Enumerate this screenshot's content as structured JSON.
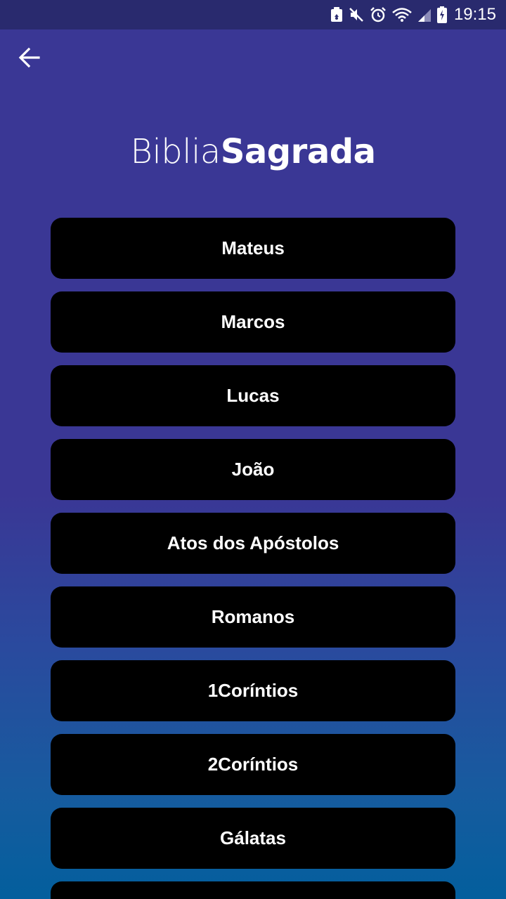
{
  "status_bar": {
    "time": "19:15",
    "icons": [
      "recycle-notification-icon",
      "mute-icon",
      "alarm-icon",
      "wifi-icon",
      "signal-icon",
      "battery-charging-icon"
    ]
  },
  "header": {
    "back_icon": "arrow-left-icon",
    "title_light": "Biblia",
    "title_bold": "Sagrada"
  },
  "books": [
    {
      "label": "Mateus"
    },
    {
      "label": "Marcos"
    },
    {
      "label": "Lucas"
    },
    {
      "label": "João"
    },
    {
      "label": "Atos dos Apóstolos"
    },
    {
      "label": "Romanos"
    },
    {
      "label": "1Coríntios"
    },
    {
      "label": "2Coríntios"
    },
    {
      "label": "Gálatas"
    },
    {
      "label": ""
    }
  ],
  "colors": {
    "status_bar": "#292a6e",
    "background_top": "#3a3795",
    "background_bottom": "#035f9d",
    "button": "#000000",
    "text": "#ffffff"
  }
}
